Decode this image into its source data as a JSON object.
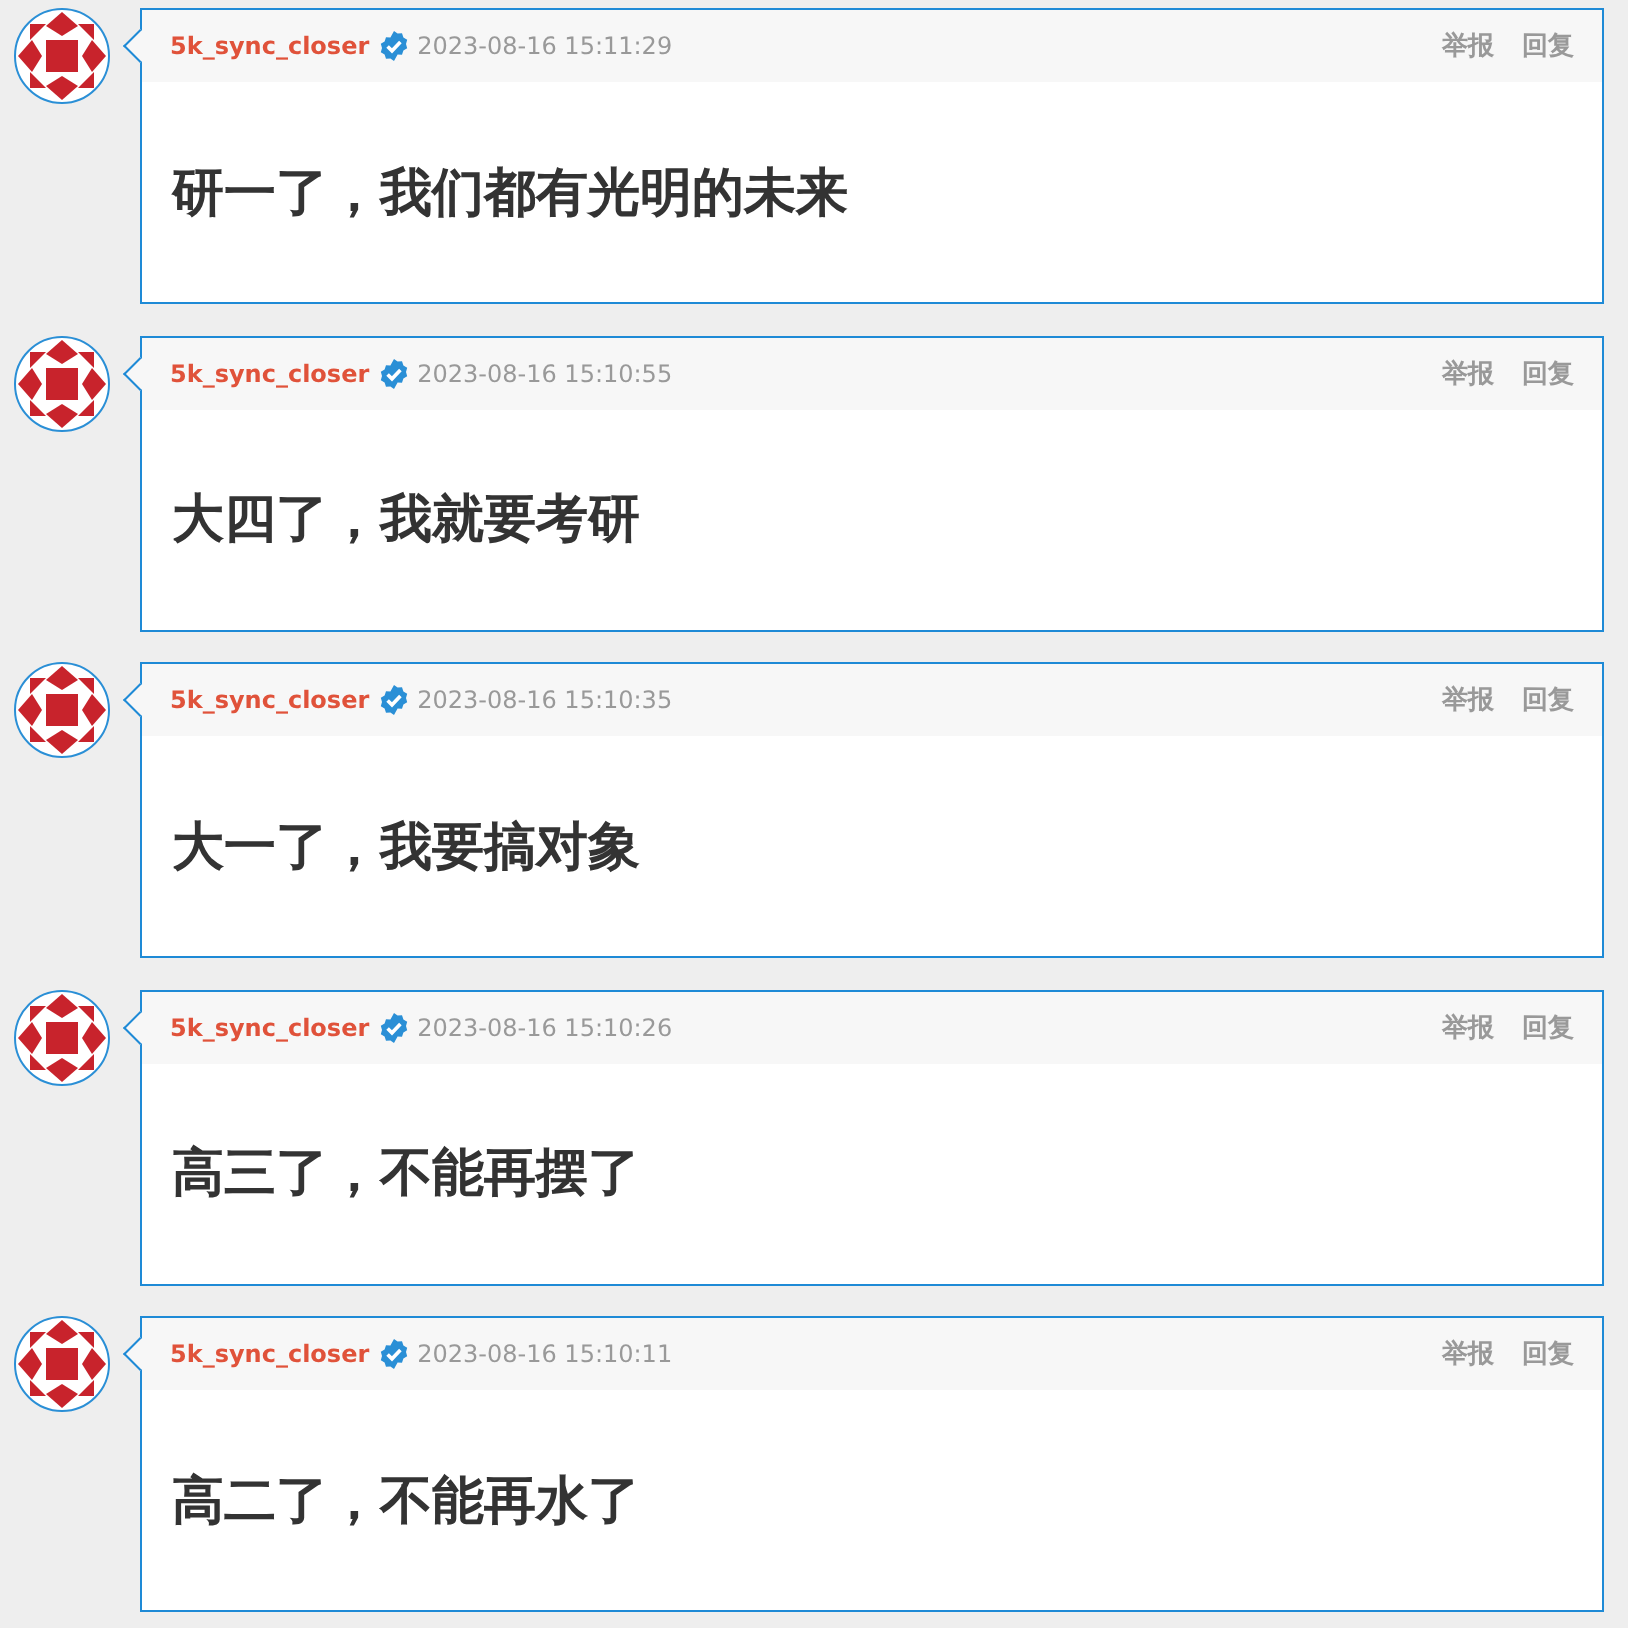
{
  "comments": [
    {
      "author": "5k_sync_closer",
      "verified": true,
      "time": "2023-08-16 15:11:29",
      "actions": [
        "举报",
        "回复"
      ],
      "text": "研一了，我们都有光明的未来"
    },
    {
      "author": "5k_sync_closer",
      "verified": true,
      "time": "2023-08-16 15:10:55",
      "actions": [
        "举报",
        "回复"
      ],
      "text": "大四了，我就要考研"
    },
    {
      "author": "5k_sync_closer",
      "verified": true,
      "time": "2023-08-16 15:10:35",
      "actions": [
        "举报",
        "回复"
      ],
      "text": "大一了，我要搞对象"
    },
    {
      "author": "5k_sync_closer",
      "verified": true,
      "time": "2023-08-16 15:10:26",
      "actions": [
        "举报",
        "回复"
      ],
      "text": "高三了，不能再摆了"
    },
    {
      "author": "5k_sync_closer",
      "verified": true,
      "time": "2023-08-16 15:10:11",
      "actions": [
        "举报",
        "回复"
      ],
      "text": "高二了，不能再水了"
    }
  ]
}
